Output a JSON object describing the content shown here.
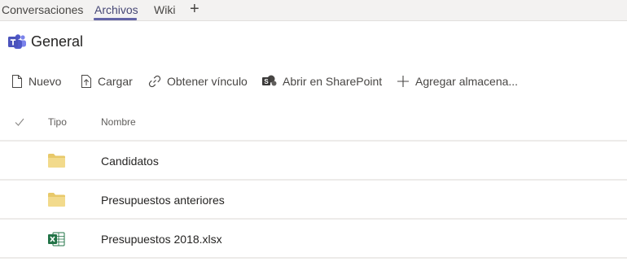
{
  "tabs": [
    {
      "label": "Conversaciones",
      "active": false
    },
    {
      "label": "Archivos",
      "active": true
    },
    {
      "label": "Wiki",
      "active": false
    }
  ],
  "tab_add_label": "+",
  "channel": {
    "title": "General",
    "icon": "teams-icon"
  },
  "toolbar": {
    "new_label": "Nuevo",
    "upload_label": "Cargar",
    "link_label": "Obtener vínculo",
    "sharepoint_label": "Abrir en SharePoint",
    "storage_label": "Agregar almacena..."
  },
  "table": {
    "columns": [
      "Tipo",
      "Nombre"
    ],
    "rows": [
      {
        "name": "Candidatos",
        "type": "folder"
      },
      {
        "name": "Presupuestos anteriores",
        "type": "folder"
      },
      {
        "name": "Presupuestos 2018.xlsx",
        "type": "excel"
      }
    ]
  },
  "colors": {
    "accent": "#6264a7",
    "folder": "#f0d98a",
    "excel": "#217346"
  }
}
